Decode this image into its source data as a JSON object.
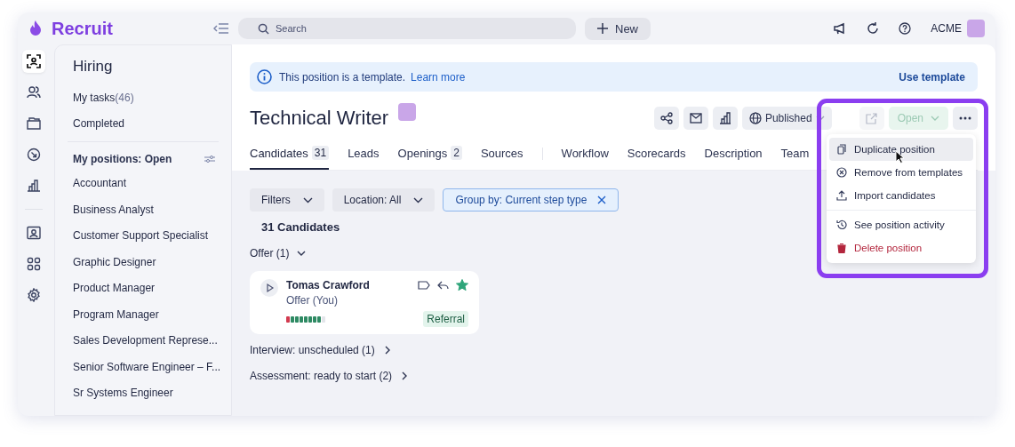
{
  "app": {
    "name": "Recruit"
  },
  "search": {
    "placeholder": "Search"
  },
  "new_button": "New",
  "account": "ACME",
  "rail": [
    {
      "selected": true
    },
    {
      "selected": false
    },
    {
      "selected": false
    },
    {
      "selected": false
    },
    {
      "selected": false
    },
    {
      "selected": false
    },
    {
      "selected": false
    },
    {
      "selected": false
    }
  ],
  "sidebar": {
    "title": "Hiring",
    "links": [
      {
        "label": "My tasks",
        "count": "(46)"
      },
      {
        "label": "Completed"
      }
    ],
    "section": "My positions: Open",
    "positions": [
      "Accountant",
      "Business Analyst",
      "Customer Support Specialist",
      "Graphic Designer",
      "Product Manager",
      "Program Manager",
      "Sales Development Represe...",
      "Senior Software Engineer – F...",
      "Sr Systems Engineer"
    ]
  },
  "banner": {
    "text": "This position is a template.",
    "link": "Learn more",
    "action": "Use template"
  },
  "position": {
    "title": "Technical Writer",
    "status": "Published",
    "state": "Open",
    "state_disabled": true
  },
  "tabs": [
    {
      "label": "Candidates",
      "count": "31",
      "selected": true
    },
    {
      "label": "Leads",
      "selected": false
    },
    {
      "label": "Openings",
      "count": "2",
      "selected": false
    },
    {
      "label": "Sources",
      "selected": false
    },
    {
      "label": "Workflow",
      "selected": false
    },
    {
      "label": "Scorecards",
      "selected": false
    },
    {
      "label": "Description",
      "selected": false
    },
    {
      "label": "Team",
      "selected": false
    }
  ],
  "filters": [
    {
      "label": "Filters",
      "kind": "dropdown"
    },
    {
      "label": "Location: All",
      "kind": "dropdown"
    },
    {
      "label": "Group by: Current step type",
      "kind": "chip"
    }
  ],
  "candidates_count": "31 Candidates",
  "groups": [
    {
      "label": "Offer (1)",
      "expanded": true,
      "cards": [
        {
          "name": "Tomas Crawford",
          "step": "Offer (You)",
          "tag": "Referral",
          "starred": true,
          "segments": [
            {
              "color": "#d23a4f"
            },
            {
              "color": "#2e8a63"
            },
            {
              "color": "#2e8a63"
            },
            {
              "color": "#2e8a63"
            },
            {
              "color": "#2e8a63"
            },
            {
              "color": "#2e8a63"
            },
            {
              "color": "#2e8a63"
            },
            {
              "color": "#2e8a63"
            },
            {
              "color": "#e3e5ea"
            }
          ]
        }
      ]
    },
    {
      "label": "Interview: unscheduled (1)",
      "expanded": false
    },
    {
      "label": "Assessment: ready to start (2)",
      "expanded": false
    }
  ],
  "menu": {
    "items": [
      {
        "label": "Duplicate position",
        "kind": "normal",
        "selected": true
      },
      {
        "label": "Remove from templates",
        "kind": "normal",
        "selected": false
      },
      {
        "label": "Import candidates",
        "kind": "normal",
        "selected": false
      },
      {
        "label": "See position activity",
        "kind": "separator-before",
        "selected": false
      },
      {
        "label": "Delete position",
        "kind": "danger",
        "selected": false
      }
    ]
  }
}
